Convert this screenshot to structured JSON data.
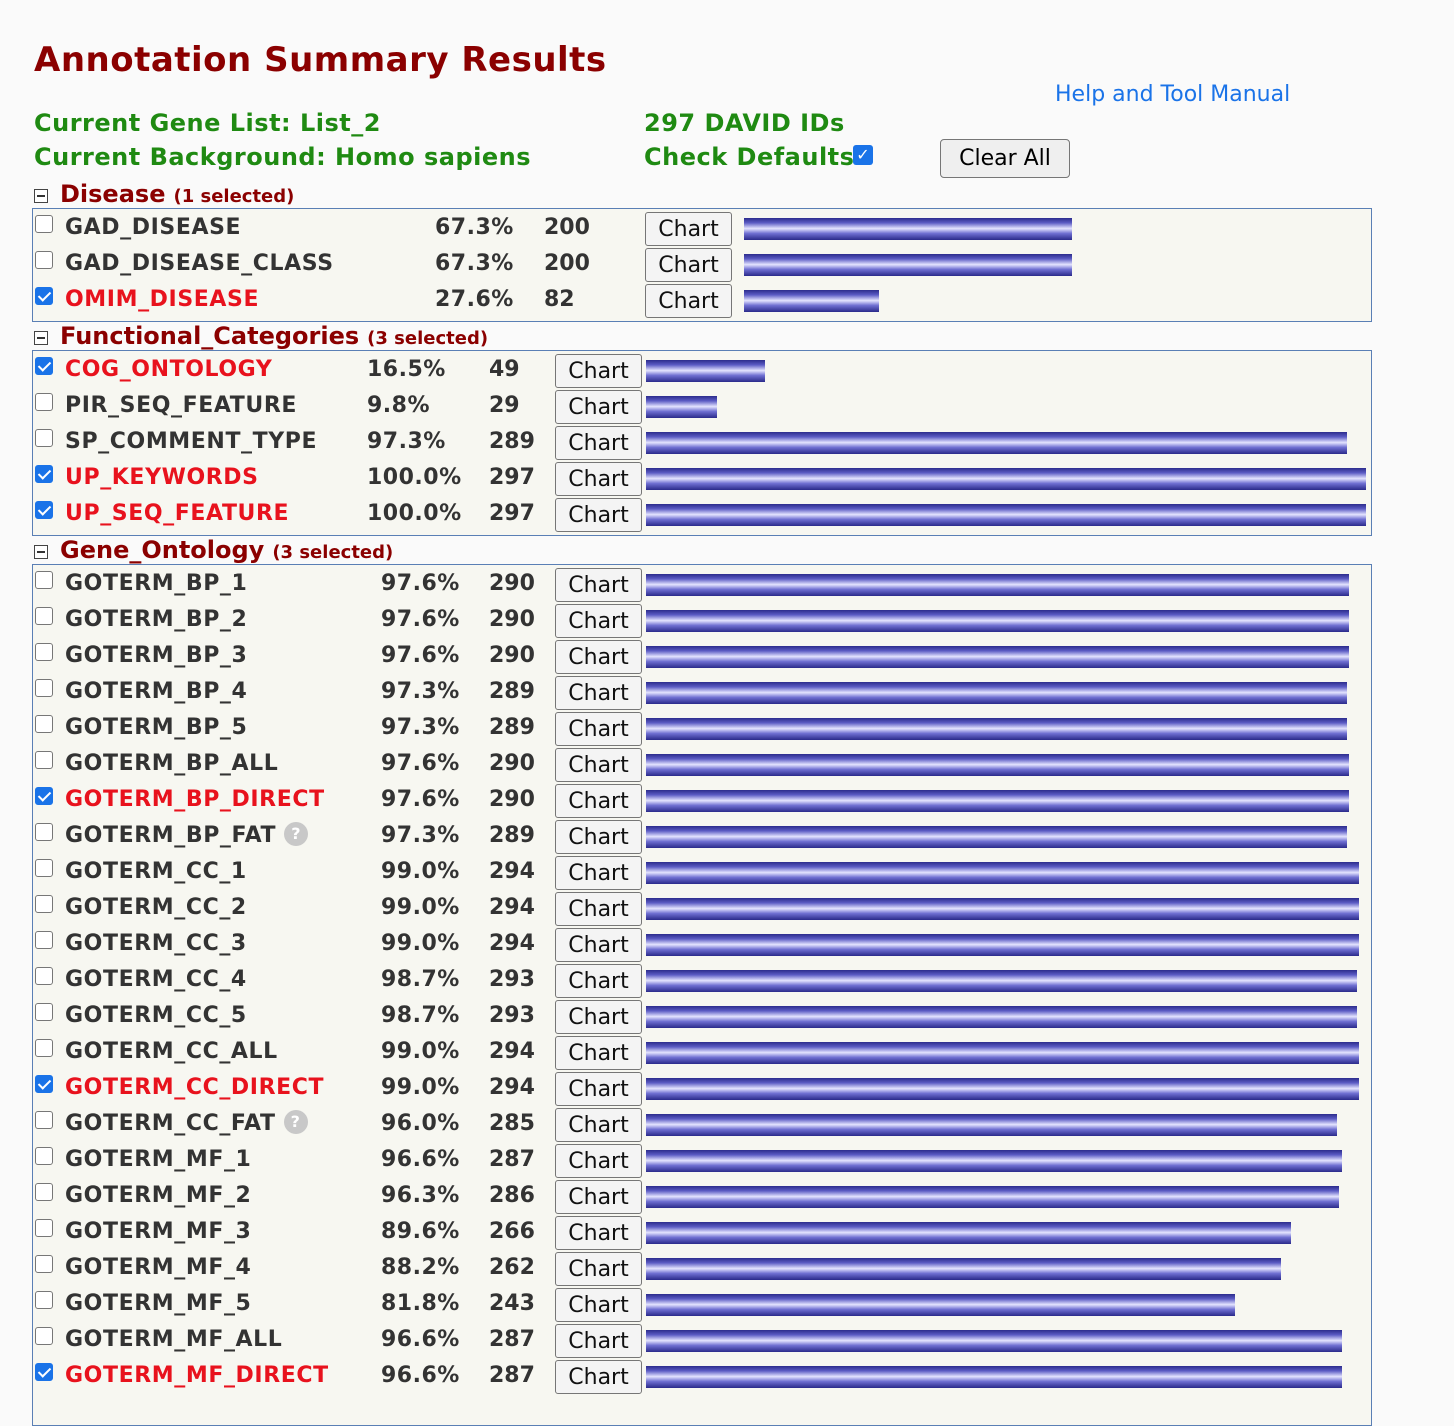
{
  "header": {
    "title": "Annotation Summary Results",
    "help_link": "Help and Tool Manual",
    "gene_list": "Current Gene List: List_2",
    "background": "Current Background: Homo sapiens",
    "david_ids": "297 DAVID IDs",
    "check_defaults": "Check Defaults",
    "check_defaults_checked": true,
    "clear_all": "Clear All"
  },
  "colors": {
    "title": "#8b0000",
    "info": "#1f8a12",
    "selected": "#e8121d",
    "link": "#1a73e8",
    "bar": "#5b5bc4"
  },
  "sections": [
    {
      "name": "Disease",
      "selected_label": "(1 selected)",
      "rows": [
        {
          "name": "GAD_DISEASE",
          "pct": "67.3%",
          "count": "200",
          "checked": false,
          "chart": "Chart",
          "fraction": 0.673
        },
        {
          "name": "GAD_DISEASE_CLASS",
          "pct": "67.3%",
          "count": "200",
          "checked": false,
          "chart": "Chart",
          "fraction": 0.673
        },
        {
          "name": "OMIM_DISEASE",
          "pct": "27.6%",
          "count": "82",
          "checked": true,
          "chart": "Chart",
          "fraction": 0.276
        }
      ]
    },
    {
      "name": "Functional_Categories",
      "selected_label": "(3 selected)",
      "rows": [
        {
          "name": "COG_ONTOLOGY",
          "pct": "16.5%",
          "count": "49",
          "checked": true,
          "chart": "Chart",
          "fraction": 0.165
        },
        {
          "name": "PIR_SEQ_FEATURE",
          "pct": "9.8%",
          "count": "29",
          "checked": false,
          "chart": "Chart",
          "fraction": 0.098
        },
        {
          "name": "SP_COMMENT_TYPE",
          "pct": "97.3%",
          "count": "289",
          "checked": false,
          "chart": "Chart",
          "fraction": 0.973
        },
        {
          "name": "UP_KEYWORDS",
          "pct": "100.0%",
          "count": "297",
          "checked": true,
          "chart": "Chart",
          "fraction": 1.0
        },
        {
          "name": "UP_SEQ_FEATURE",
          "pct": "100.0%",
          "count": "297",
          "checked": true,
          "chart": "Chart",
          "fraction": 1.0
        }
      ]
    },
    {
      "name": "Gene_Ontology",
      "selected_label": "(3 selected)",
      "rows": [
        {
          "name": "GOTERM_BP_1",
          "pct": "97.6%",
          "count": "290",
          "checked": false,
          "chart": "Chart",
          "fraction": 0.976
        },
        {
          "name": "GOTERM_BP_2",
          "pct": "97.6%",
          "count": "290",
          "checked": false,
          "chart": "Chart",
          "fraction": 0.976
        },
        {
          "name": "GOTERM_BP_3",
          "pct": "97.6%",
          "count": "290",
          "checked": false,
          "chart": "Chart",
          "fraction": 0.976
        },
        {
          "name": "GOTERM_BP_4",
          "pct": "97.3%",
          "count": "289",
          "checked": false,
          "chart": "Chart",
          "fraction": 0.973
        },
        {
          "name": "GOTERM_BP_5",
          "pct": "97.3%",
          "count": "289",
          "checked": false,
          "chart": "Chart",
          "fraction": 0.973
        },
        {
          "name": "GOTERM_BP_ALL",
          "pct": "97.6%",
          "count": "290",
          "checked": false,
          "chart": "Chart",
          "fraction": 0.976
        },
        {
          "name": "GOTERM_BP_DIRECT",
          "pct": "97.6%",
          "count": "290",
          "checked": true,
          "chart": "Chart",
          "fraction": 0.976
        },
        {
          "name": "GOTERM_BP_FAT",
          "pct": "97.3%",
          "count": "289",
          "checked": false,
          "chart": "Chart",
          "fraction": 0.973,
          "help": true
        },
        {
          "name": "GOTERM_CC_1",
          "pct": "99.0%",
          "count": "294",
          "checked": false,
          "chart": "Chart",
          "fraction": 0.99
        },
        {
          "name": "GOTERM_CC_2",
          "pct": "99.0%",
          "count": "294",
          "checked": false,
          "chart": "Chart",
          "fraction": 0.99
        },
        {
          "name": "GOTERM_CC_3",
          "pct": "99.0%",
          "count": "294",
          "checked": false,
          "chart": "Chart",
          "fraction": 0.99
        },
        {
          "name": "GOTERM_CC_4",
          "pct": "98.7%",
          "count": "293",
          "checked": false,
          "chart": "Chart",
          "fraction": 0.987
        },
        {
          "name": "GOTERM_CC_5",
          "pct": "98.7%",
          "count": "293",
          "checked": false,
          "chart": "Chart",
          "fraction": 0.987
        },
        {
          "name": "GOTERM_CC_ALL",
          "pct": "99.0%",
          "count": "294",
          "checked": false,
          "chart": "Chart",
          "fraction": 0.99
        },
        {
          "name": "GOTERM_CC_DIRECT",
          "pct": "99.0%",
          "count": "294",
          "checked": true,
          "chart": "Chart",
          "fraction": 0.99
        },
        {
          "name": "GOTERM_CC_FAT",
          "pct": "96.0%",
          "count": "285",
          "checked": false,
          "chart": "Chart",
          "fraction": 0.96,
          "help": true
        },
        {
          "name": "GOTERM_MF_1",
          "pct": "96.6%",
          "count": "287",
          "checked": false,
          "chart": "Chart",
          "fraction": 0.966
        },
        {
          "name": "GOTERM_MF_2",
          "pct": "96.3%",
          "count": "286",
          "checked": false,
          "chart": "Chart",
          "fraction": 0.963
        },
        {
          "name": "GOTERM_MF_3",
          "pct": "89.6%",
          "count": "266",
          "checked": false,
          "chart": "Chart",
          "fraction": 0.896
        },
        {
          "name": "GOTERM_MF_4",
          "pct": "88.2%",
          "count": "262",
          "checked": false,
          "chart": "Chart",
          "fraction": 0.882
        },
        {
          "name": "GOTERM_MF_5",
          "pct": "81.8%",
          "count": "243",
          "checked": false,
          "chart": "Chart",
          "fraction": 0.818
        },
        {
          "name": "GOTERM_MF_ALL",
          "pct": "96.6%",
          "count": "287",
          "checked": false,
          "chart": "Chart",
          "fraction": 0.966
        },
        {
          "name": "GOTERM_MF_DIRECT",
          "pct": "96.6%",
          "count": "287",
          "checked": true,
          "chart": "Chart",
          "fraction": 0.966
        }
      ]
    }
  ]
}
